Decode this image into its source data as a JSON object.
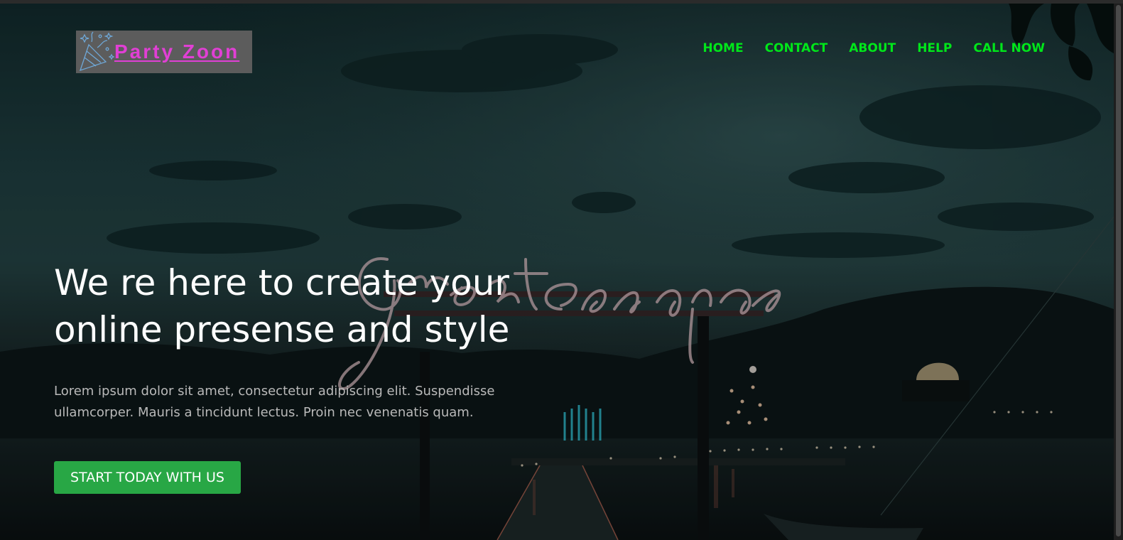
{
  "brand": {
    "name": "Party Zoon",
    "icon": "party-popper-icon",
    "text_color": "#e13fd5",
    "box_color": "#5c5c5c"
  },
  "nav": {
    "items": [
      {
        "label": "HOME"
      },
      {
        "label": "CONTACT"
      },
      {
        "label": "ABOUT"
      },
      {
        "label": "HELP"
      },
      {
        "label": "CALL NOW"
      }
    ],
    "color": "#00e61a"
  },
  "hero": {
    "headline": "We re here to create your online presense and style",
    "lede": "Lorem ipsum dolor sit amet, consectetur adipiscing elit. Suspendisse ullamcorper. Mauris a tincidunt lectus. Proin nec venenatis quam.",
    "cta_label": "START TODAY WITH US",
    "cta_color": "#28a745",
    "neon_sign_text": "Great escape"
  }
}
